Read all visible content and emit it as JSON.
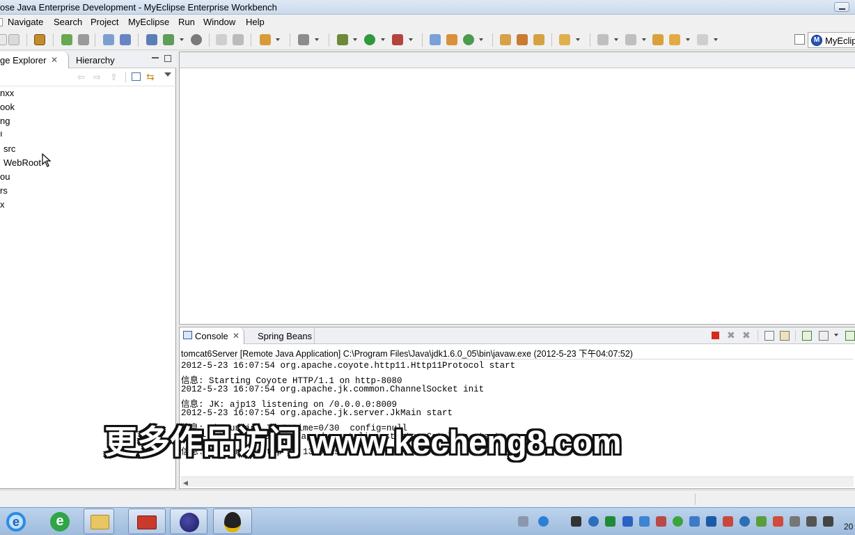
{
  "window": {
    "title": "ose Java Enterprise Development - MyEclipse Enterprise Workbench"
  },
  "menu": [
    "Navigate",
    "Search",
    "Project",
    "MyEclipse",
    "Run",
    "Window",
    "Help"
  ],
  "perspective": {
    "label": "MyEclips",
    "icon": "myeclipse-logo-icon"
  },
  "package_explorer": {
    "tabs": [
      {
        "label": "ge Explorer",
        "active": true
      },
      {
        "label": "Hierarchy",
        "active": false
      }
    ],
    "tree": [
      "nxx",
      "ook",
      "ng",
      "ı",
      "src",
      "WebRoot",
      "ou",
      "rs",
      "x"
    ]
  },
  "console": {
    "tabs": [
      {
        "label": "Console",
        "active": true
      },
      {
        "label": "Spring Beans",
        "active": false
      }
    ],
    "description": "tomcat6Server [Remote Java Application] C:\\Program Files\\Java\\jdk1.6.0_05\\bin\\javaw.exe (2012-5-23 下午04:07:52)",
    "lines": [
      "2012-5-23 16:07:54 org.apache.coyote.http11.Http11Protocol start",
      "信息: Starting Coyote HTTP/1.1 on http-8080",
      "2012-5-23 16:07:54 org.apache.jk.common.ChannelSocket init",
      "信息: JK: ajp13 listening on /0.0.0.0:8009",
      "2012-5-23 16:07:54 org.apache.jk.server.JkMain start",
      "信息: Jk running ID=0 time=0/30  config=null",
      "2012-5-23 16:07:54 org.apache.catalina.startup.Catalina start",
      "信息: Server startup in 1329 ms"
    ]
  },
  "watermark": "更多作品访问 www.kecheng8.com",
  "taskbar": {
    "apps": [
      "ie-icon",
      "ie-icon",
      "explorer-folder-icon",
      "toolbox-icon",
      "eclipse-icon",
      "qq-icon"
    ],
    "clock": "20"
  },
  "colors": {
    "title_bar": "#c9d9ec",
    "taskbar": "#9fbbdc",
    "stop_button": "#d52b1e"
  }
}
